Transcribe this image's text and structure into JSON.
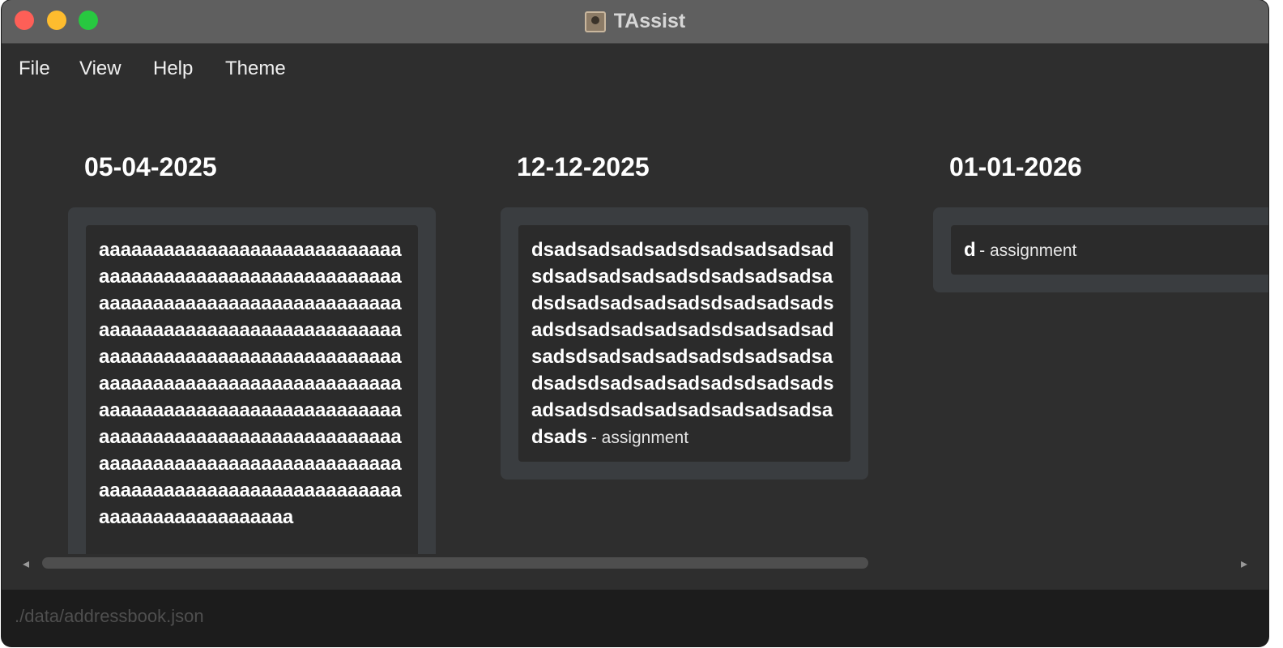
{
  "window": {
    "title": "TAssist",
    "app_icon": "address-book-icon"
  },
  "menu": {
    "file": "File",
    "view": "View",
    "help": "Help",
    "theme": "Theme"
  },
  "columns": [
    {
      "date": "05-04-2025",
      "items": [
        {
          "name": "aaaaaaaaaaaaaaaaaaaaaaaaaaaaaaaaaaaaaaaaaaaaaaaaaaaaaaaaaaaaaaaaaaaaaaaaaaaaaaaaaaaaaaaaaaaaaaaaaaaaaaaaaaaaaaaaaaaaaaaaaaaaaaaaaaaaaaaaaaaaaaaaaaaaaaaaaaaaaaaaaaaaaaaaaaaaaaaaaaaaaaaaaaaaaaaaaaaaaaaaaaaaaaaaaaaaaaaaaaaaaaaaaaaaaaaaaaaaaaaaaaaaaaaaaaaaaaaaaaaaaaaaaaaaaaaaaaaaaaaaaaaaaaaaaaaaaaaaaa",
          "type": ""
        }
      ]
    },
    {
      "date": "12-12-2025",
      "items": [
        {
          "name": "dsadsadsadsadsdsadsadsadsadsdsadsadsadsadsdsadsadsadsadsdsadsadsadsadsdsadsadsadsadsdsadsadsadsadsdsadsadsadsadsdsadsadsadsadsdsadsadsadsadsdsadsadsadsadsdsadsadsadsadsdsadsadsadsadsadsadsadsads",
          "type": "- assignment"
        }
      ]
    },
    {
      "date": "01-01-2026",
      "items": [
        {
          "name": "d",
          "type": "- assignment"
        }
      ]
    }
  ],
  "status": {
    "path": "./data/addressbook.json"
  },
  "colors": {
    "window_bg": "#2e2e2e",
    "panel_bg": "#3a3d40",
    "card_bg": "#2b2b2b",
    "titlebar_bg": "#5f5f5f",
    "statusbar_bg": "#1c1c1c"
  }
}
